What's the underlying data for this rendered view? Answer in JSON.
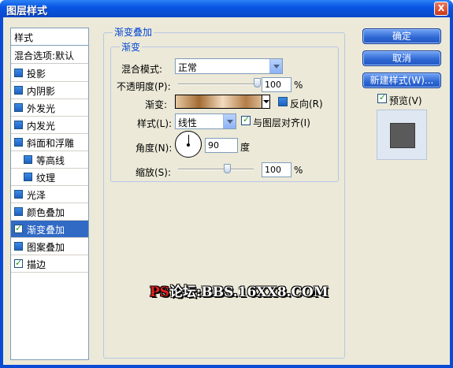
{
  "window": {
    "title": "图层样式",
    "close_label": "X"
  },
  "styles_list": {
    "header": "样式",
    "blend_options": "混合选项:默认",
    "items": [
      {
        "label": "投影",
        "checked": false,
        "sub": false
      },
      {
        "label": "内阴影",
        "checked": false,
        "sub": false
      },
      {
        "label": "外发光",
        "checked": false,
        "sub": false
      },
      {
        "label": "内发光",
        "checked": false,
        "sub": false
      },
      {
        "label": "斜面和浮雕",
        "checked": false,
        "sub": false
      },
      {
        "label": "等高线",
        "checked": false,
        "sub": true
      },
      {
        "label": "纹理",
        "checked": false,
        "sub": true
      },
      {
        "label": "光泽",
        "checked": false,
        "sub": false
      },
      {
        "label": "颜色叠加",
        "checked": false,
        "sub": false
      },
      {
        "label": "渐变叠加",
        "checked": true,
        "sub": false,
        "selected": true
      },
      {
        "label": "图案叠加",
        "checked": false,
        "sub": false
      },
      {
        "label": "描边",
        "checked": true,
        "sub": false
      }
    ]
  },
  "panel": {
    "outer_title": "渐变叠加",
    "inner_title": "渐变",
    "blend_mode": {
      "label": "混合模式:",
      "value": "正常"
    },
    "opacity": {
      "label": "不透明度(P):",
      "value": "100",
      "unit": "%",
      "level": 1.0
    },
    "gradient": {
      "label": "渐变:",
      "reverse_label": "反向(R)",
      "reverse_checked": false
    },
    "style": {
      "label": "样式(L):",
      "value": "线性",
      "align_label": "与图层对齐(I)",
      "align_checked": true
    },
    "angle": {
      "label": "角度(N):",
      "value": "90",
      "unit": "度"
    },
    "scale": {
      "label": "缩放(S):",
      "value": "100",
      "unit": "%",
      "level": 0.6
    }
  },
  "buttons": {
    "ok": "确定",
    "cancel": "取消",
    "new_style": "新建样式(W)...",
    "preview_label": "预览(V)",
    "preview_checked": true
  },
  "watermark": {
    "ps": "PS",
    "rest": "论坛:BBS.16XX8.COM"
  }
}
